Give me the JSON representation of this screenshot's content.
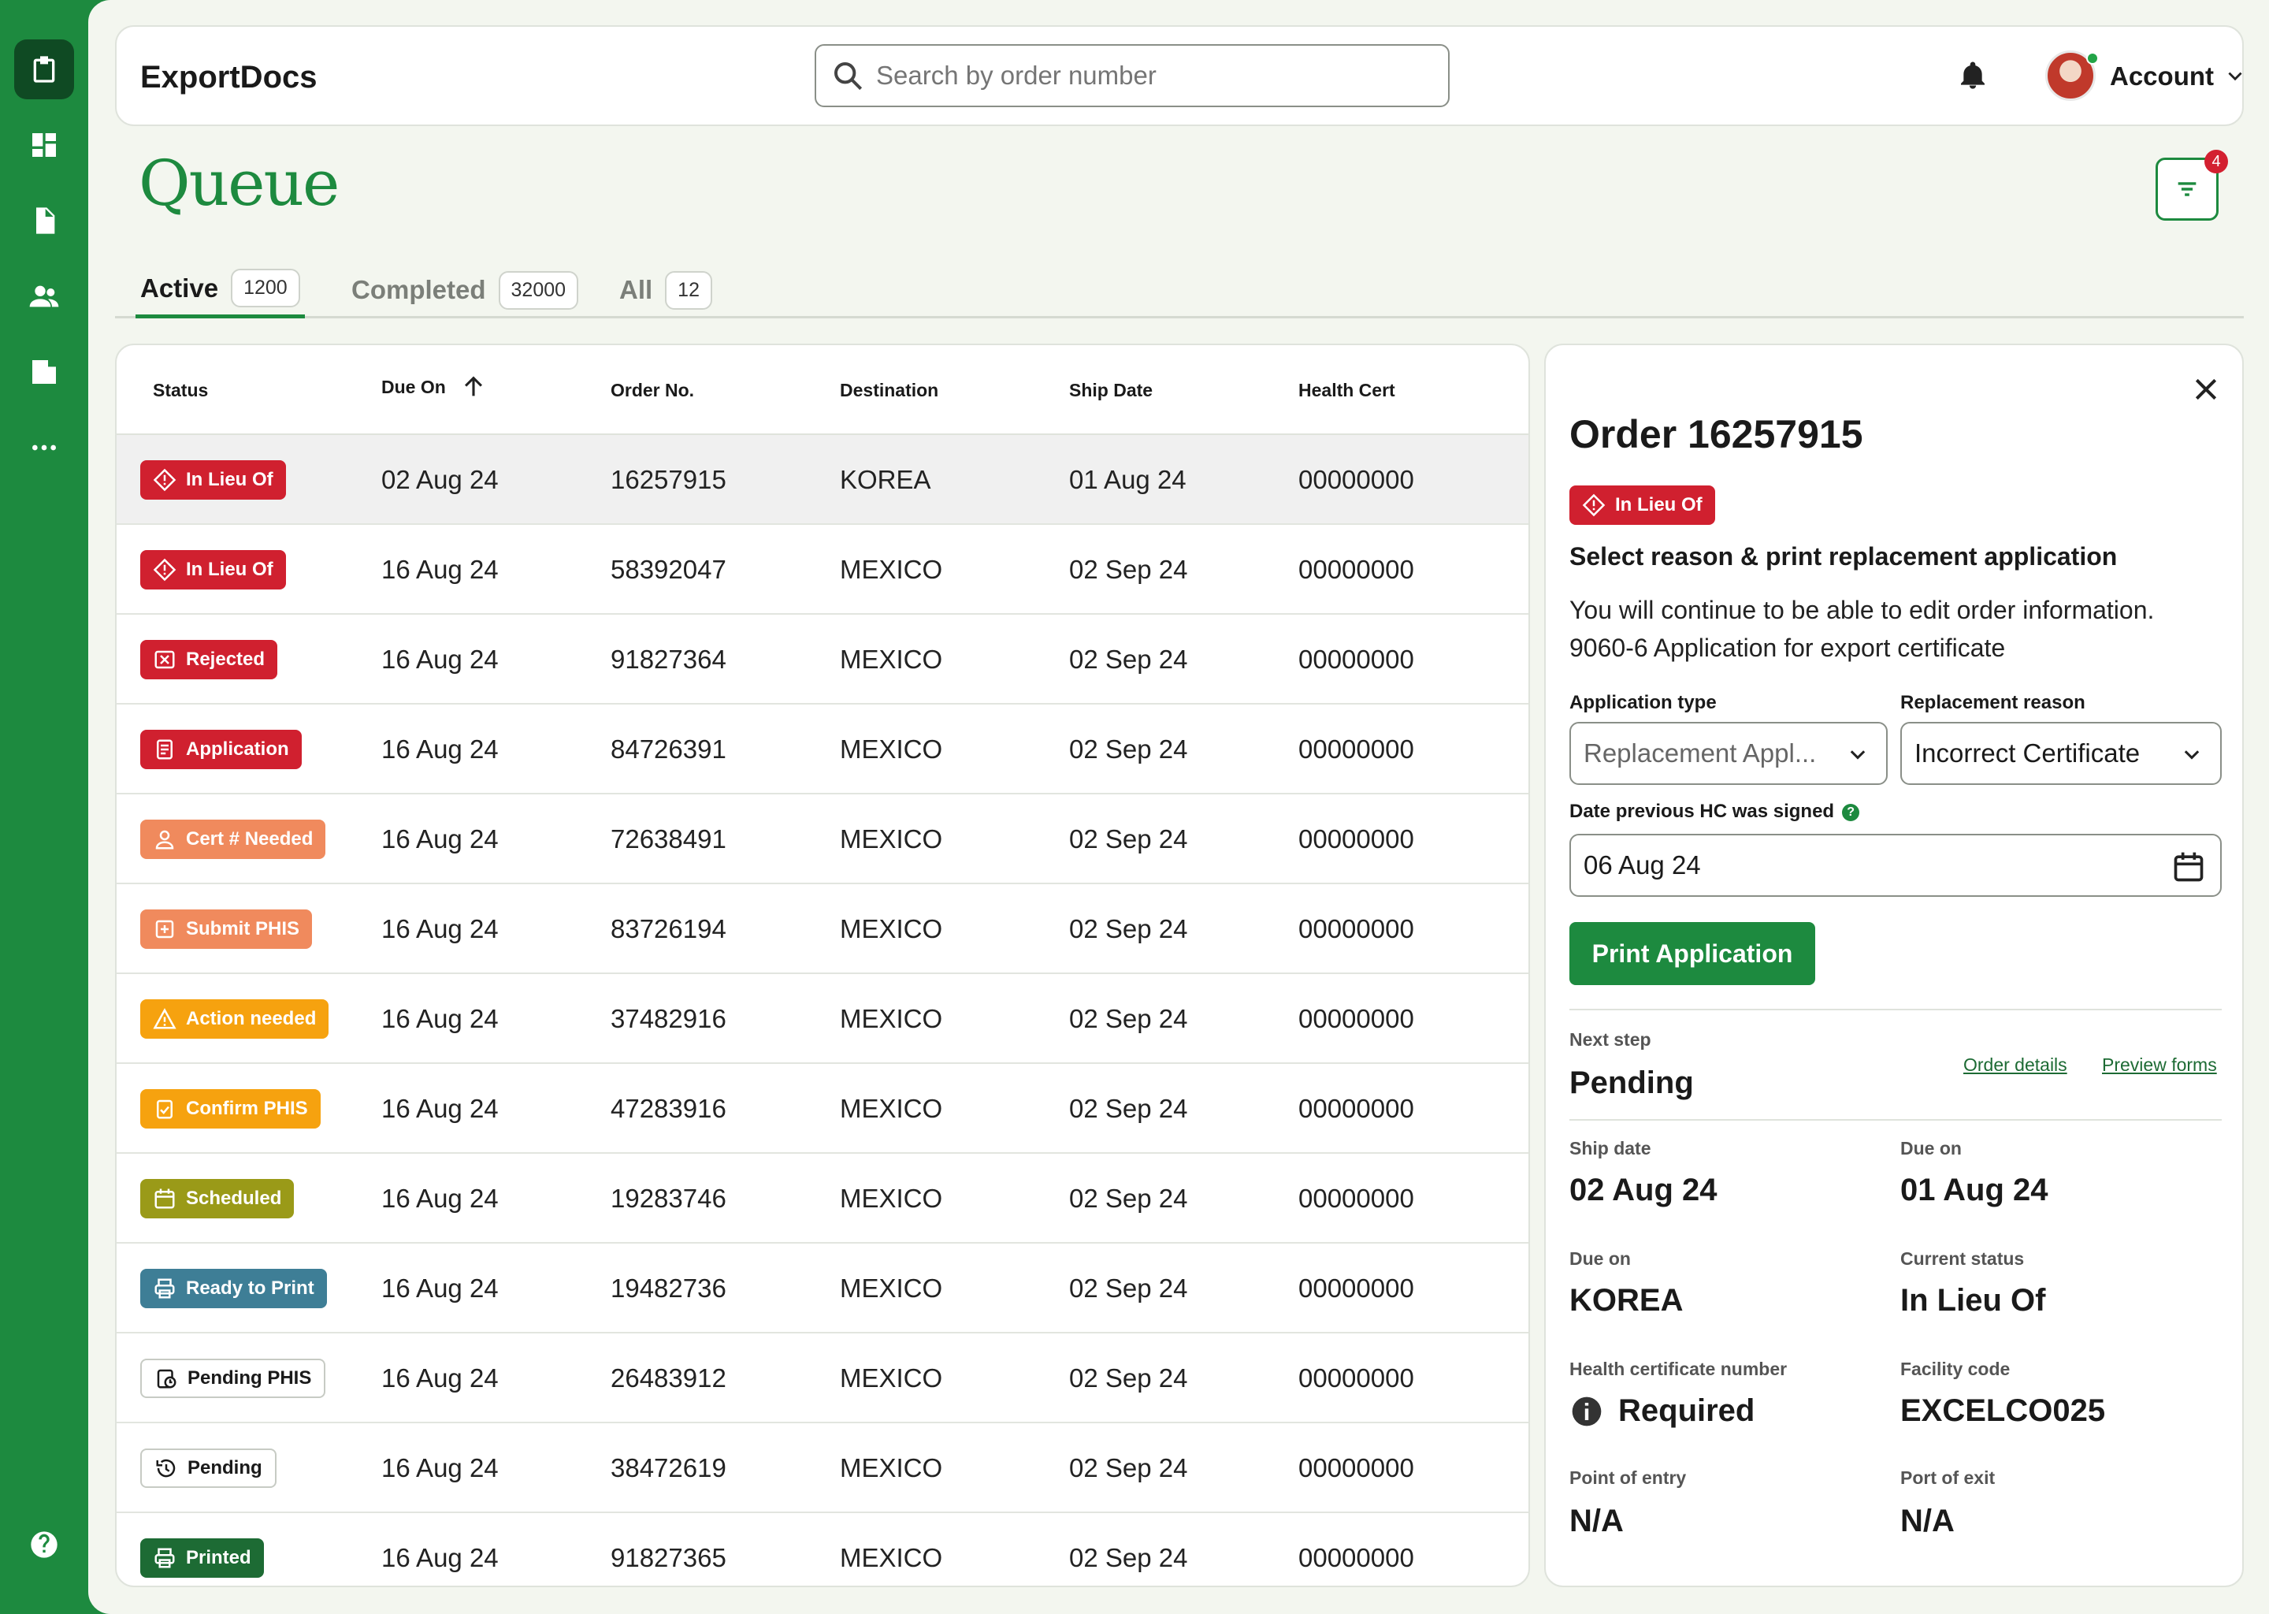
{
  "app": {
    "title": "ExportDocs"
  },
  "search": {
    "placeholder": "Search by order number"
  },
  "account": {
    "label": "Account"
  },
  "page": {
    "title": "Queue",
    "filter_badge": "4"
  },
  "tabs": [
    {
      "label": "Active",
      "count": "1200"
    },
    {
      "label": "Completed",
      "count": "32000"
    },
    {
      "label": "All",
      "count": "12"
    }
  ],
  "table": {
    "headers": [
      "Status",
      "Due On",
      "Order No.",
      "Destination",
      "Ship Date",
      "Health Cert"
    ],
    "rows": [
      {
        "status": "In Lieu Of",
        "due": "02 Aug 24",
        "order": "16257915",
        "dest": "KOREA",
        "ship": "01 Aug 24",
        "cert": "00000000"
      },
      {
        "status": "In Lieu Of",
        "due": "16 Aug 24",
        "order": "58392047",
        "dest": "MEXICO",
        "ship": "02 Sep 24",
        "cert": "00000000"
      },
      {
        "status": "Rejected",
        "due": "16 Aug 24",
        "order": "91827364",
        "dest": "MEXICO",
        "ship": "02 Sep 24",
        "cert": "00000000"
      },
      {
        "status": "Application",
        "due": "16 Aug 24",
        "order": "84726391",
        "dest": "MEXICO",
        "ship": "02 Sep 24",
        "cert": "00000000"
      },
      {
        "status": "Cert # Needed",
        "due": "16 Aug 24",
        "order": "72638491",
        "dest": "MEXICO",
        "ship": "02 Sep 24",
        "cert": "00000000"
      },
      {
        "status": "Submit PHIS",
        "due": "16 Aug 24",
        "order": "83726194",
        "dest": "MEXICO",
        "ship": "02 Sep 24",
        "cert": "00000000"
      },
      {
        "status": "Action needed",
        "due": "16 Aug 24",
        "order": "37482916",
        "dest": "MEXICO",
        "ship": "02 Sep 24",
        "cert": "00000000"
      },
      {
        "status": "Confirm PHIS",
        "due": "16 Aug 24",
        "order": "47283916",
        "dest": "MEXICO",
        "ship": "02 Sep 24",
        "cert": "00000000"
      },
      {
        "status": "Scheduled",
        "due": "16 Aug 24",
        "order": "19283746",
        "dest": "MEXICO",
        "ship": "02 Sep 24",
        "cert": "00000000"
      },
      {
        "status": "Ready to Print",
        "due": "16 Aug 24",
        "order": "19482736",
        "dest": "MEXICO",
        "ship": "02 Sep 24",
        "cert": "00000000"
      },
      {
        "status": "Pending PHIS",
        "due": "16 Aug 24",
        "order": "26483912",
        "dest": "MEXICO",
        "ship": "02 Sep 24",
        "cert": "00000000"
      },
      {
        "status": "Pending",
        "due": "16 Aug 24",
        "order": "38472619",
        "dest": "MEXICO",
        "ship": "02 Sep 24",
        "cert": "00000000"
      },
      {
        "status": "Printed",
        "due": "16 Aug 24",
        "order": "91827365",
        "dest": "MEXICO",
        "ship": "02 Sep 24",
        "cert": "00000000"
      }
    ]
  },
  "status_colors": {
    "In Lieu Of": "#d0202f",
    "Rejected": "#d0202f",
    "Application": "#d0202f",
    "Cert # Needed": "#f08a5d",
    "Submit PHIS": "#f08a5d",
    "Action needed": "#f6a20f",
    "Confirm PHIS": "#f6a20f",
    "Scheduled": "#9a9a18",
    "Ready to Print": "#3e7e96",
    "Pending PHIS": "outline",
    "Pending": "outline",
    "Printed": "#1d6b34"
  },
  "detail": {
    "title": "Order 16257915",
    "status": "In Lieu Of",
    "heading": "Select reason & print replacement application",
    "desc_1": "You will continue to be able to edit order information.",
    "desc_2": "9060-6 Application for export certificate",
    "application_type_label": "Application type",
    "application_type_value": "Replacement Appl...",
    "replacement_reason_label": "Replacement reason",
    "replacement_reason_value": "Incorrect Certificate",
    "date_label": "Date previous HC was signed",
    "date_value": "06 Aug 24",
    "print_button": "Print Application",
    "next_step_label": "Next step",
    "next_step_value": "Pending",
    "link_order_details": "Order details",
    "link_preview_forms": "Preview forms",
    "fields": [
      {
        "label": "Ship date",
        "value": "02 Aug 24"
      },
      {
        "label": "Due on",
        "value": "01 Aug 24"
      },
      {
        "label": "Due on",
        "value": "KOREA"
      },
      {
        "label": "Current status",
        "value": "In Lieu Of"
      },
      {
        "label": "Health certificate number",
        "value": "Required"
      },
      {
        "label": "Facility code",
        "value": "EXCELCO025"
      },
      {
        "label": "Point of entry",
        "value": "N/A"
      },
      {
        "label": "Port of exit",
        "value": "N/A"
      }
    ]
  }
}
